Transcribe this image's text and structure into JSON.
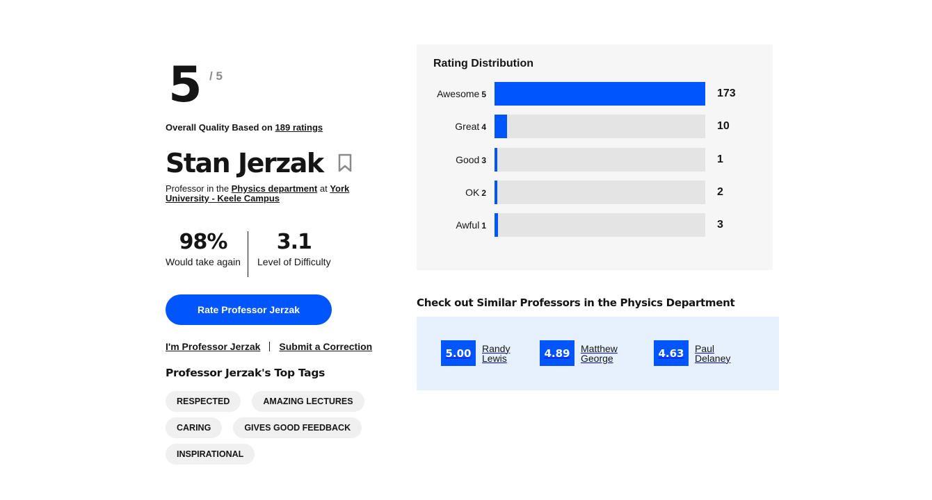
{
  "overall": {
    "score": "5",
    "max": "/ 5",
    "based_on": "Overall Quality Based on",
    "ratings_link": "189 ratings"
  },
  "professor": {
    "name": "Stan Jerzak",
    "bookmark_icon": "bookmark-icon",
    "dept_prefix": "Professor in the",
    "department": "Physics department",
    "at": "at",
    "school": "York University - Keele Campus"
  },
  "feedback": {
    "would_take_again_value": "98%",
    "would_take_again_label": "Would take again",
    "difficulty_value": "3.1",
    "difficulty_label": "Level of Difficulty"
  },
  "actions": {
    "rate_button": "Rate Professor Jerzak",
    "im_professor": "I'm Professor Jerzak",
    "submit_correction": "Submit a Correction"
  },
  "tags_section": {
    "title": "Professor Jerzak's Top Tags",
    "tags": [
      "Respected",
      "Amazing lectures",
      "Caring",
      "Gives good feedback",
      "Inspirational"
    ]
  },
  "chart_data": {
    "type": "bar",
    "title": "Rating Distribution",
    "categories": [
      "Awesome",
      "Great",
      "Good",
      "OK",
      "Awful"
    ],
    "category_numbers": [
      "5",
      "4",
      "3",
      "2",
      "1"
    ],
    "values": [
      173,
      10,
      1,
      2,
      3
    ],
    "xlim": [
      0,
      173
    ],
    "orientation": "horizontal",
    "bar_color": "#0055fd",
    "track_color": "#e4e4e4"
  },
  "similar": {
    "title": "Check out Similar Professors in the Physics Department",
    "professors": [
      {
        "score": "5.00",
        "name": "Randy Lewis"
      },
      {
        "score": "4.89",
        "name": "Matthew George"
      },
      {
        "score": "4.63",
        "name": "Paul Delaney"
      }
    ]
  },
  "colors": {
    "accent": "#0055fd",
    "similar_bg": "#e7f1fe",
    "panel_bg": "#f6f6f6",
    "tag_bg": "#f0f0f0"
  }
}
